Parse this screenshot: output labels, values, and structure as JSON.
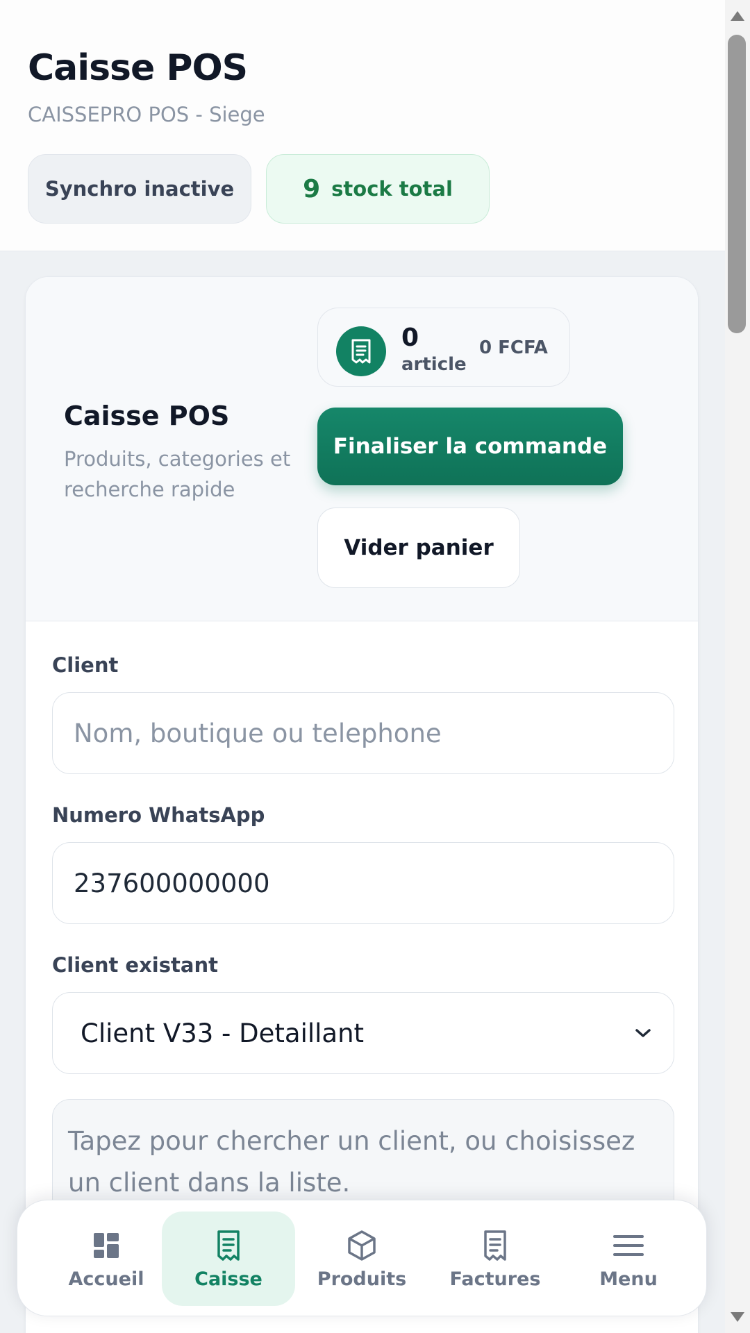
{
  "header": {
    "title": "Caisse POS",
    "subtitle": "CAISSEPRO POS - Siege",
    "sync_status": "Synchro inactive",
    "stock_count": "9",
    "stock_label": "stock total"
  },
  "cart": {
    "title": "Caisse POS",
    "description": "Produits, categories et recherche rapide",
    "item_count": "0",
    "item_label": "article",
    "total": "0 FCFA",
    "finalize_label": "Finaliser la commande",
    "empty_label": "Vider panier"
  },
  "form": {
    "client_label": "Client",
    "client_placeholder": "Nom, boutique ou telephone",
    "whatsapp_label": "Numero WhatsApp",
    "whatsapp_value": "237600000000",
    "existing_label": "Client existant",
    "existing_selected": "Client V33 - Detaillant",
    "helper_text": "Tapez pour chercher un client, ou choisissez un client dans la liste."
  },
  "nav": {
    "items": [
      {
        "label": "Accueil",
        "icon": "dashboard-icon",
        "active": false
      },
      {
        "label": "Caisse",
        "icon": "receipt-icon",
        "active": true
      },
      {
        "label": "Produits",
        "icon": "box-icon",
        "active": false
      },
      {
        "label": "Factures",
        "icon": "invoice-icon",
        "active": false
      },
      {
        "label": "Menu",
        "icon": "menu-icon",
        "active": false
      }
    ]
  },
  "colors": {
    "accent": "#128263",
    "stock_green": "#1b7a45",
    "active_nav_bg": "#e4f5ee"
  }
}
